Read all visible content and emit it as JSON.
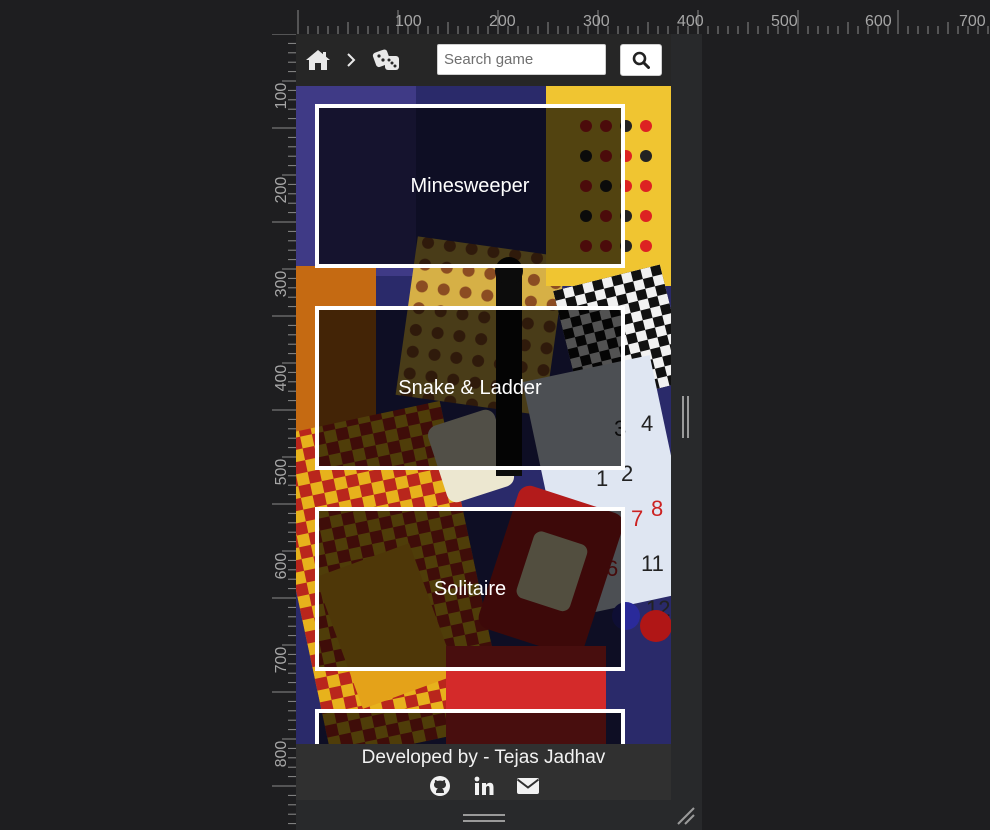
{
  "ruler": {
    "top_labels": [
      "100",
      "200",
      "300",
      "400",
      "500",
      "600",
      "700"
    ],
    "left_labels": [
      "100",
      "200",
      "300",
      "400",
      "500",
      "600",
      "700",
      "800"
    ]
  },
  "navbar": {
    "home_icon": "home-icon",
    "separator_icon": "chevron-right-icon",
    "games_icon": "dice-icon",
    "search": {
      "placeholder": "Search game",
      "value": ""
    },
    "search_button_icon": "search-icon"
  },
  "games": [
    {
      "label": "Minesweeper"
    },
    {
      "label": "Snake & Ladder"
    },
    {
      "label": "Solitaire"
    },
    {
      "label": ""
    }
  ],
  "footer": {
    "credit": "Developed by - Tejas Jadhav",
    "icons": [
      "github-icon",
      "linkedin-icon",
      "envelope-icon"
    ]
  },
  "colors": {
    "page_bg": "#1e1e20",
    "navbar_bg": "#262626",
    "footer_bg": "#303030",
    "card_border": "#ffffff",
    "card_overlay": "rgba(0,0,0,0.66)"
  }
}
